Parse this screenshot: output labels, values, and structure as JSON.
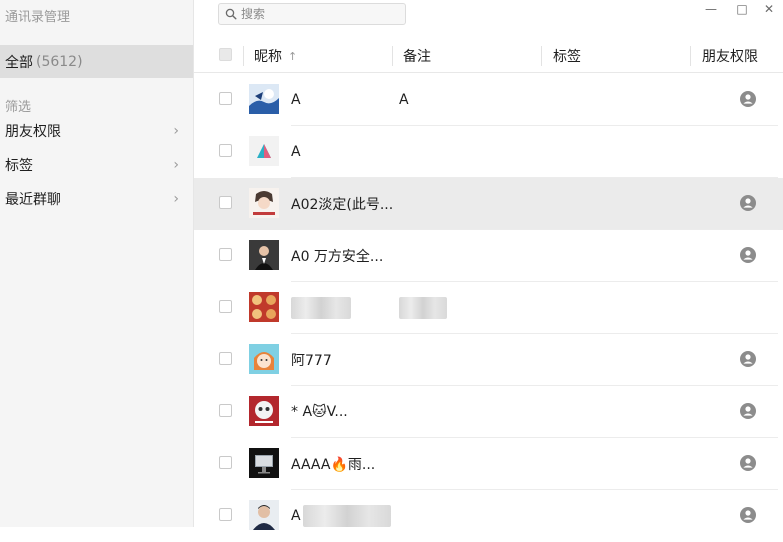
{
  "sidebar": {
    "title": "通讯录管理",
    "all_label": "全部",
    "all_count": "(5612)",
    "filter_label": "筛选",
    "items": [
      {
        "label": "朋友权限",
        "chevron": "›"
      },
      {
        "label": "标签",
        "chevron": "›"
      },
      {
        "label": "最近群聊",
        "chevron": "›"
      }
    ]
  },
  "search": {
    "placeholder": "搜索",
    "value": ""
  },
  "window_controls": {
    "minimize": "—",
    "maximize": "□",
    "close": "✕"
  },
  "table": {
    "headers": {
      "nickname": "昵称",
      "sort_indicator": "↑",
      "remark": "备注",
      "tags": "标签",
      "permission": "朋友权限"
    },
    "rows": [
      {
        "nickname": "A",
        "remark": "A",
        "avatar": "blue-illustration-avatar",
        "has_permission_icon": true,
        "blurred": false
      },
      {
        "nickname": "A",
        "remark": "",
        "avatar": "triangle-logo-avatar",
        "has_permission_icon": false,
        "blurred": false
      },
      {
        "nickname": "A02淡定(此号...",
        "remark": "",
        "avatar": "anime-character-avatar",
        "has_permission_icon": true,
        "blurred": false
      },
      {
        "nickname": "A0 万方安全...",
        "remark": "",
        "avatar": "man-in-suit-avatar",
        "has_permission_icon": true,
        "blurred": false
      },
      {
        "nickname": "",
        "remark": "",
        "avatar": "red-food-avatar",
        "has_permission_icon": false,
        "blurred": true
      },
      {
        "nickname": "阿777",
        "remark": "",
        "avatar": "cartoon-face-avatar",
        "has_permission_icon": true,
        "blurred": false
      },
      {
        "nickname": "*      A🐱V...",
        "remark": "",
        "avatar": "red-cartoon-avatar",
        "has_permission_icon": true,
        "blurred": false
      },
      {
        "nickname": "AAAA🔥雨...",
        "remark": "",
        "avatar": "monitor-avatar",
        "has_permission_icon": true,
        "blurred": false
      },
      {
        "nickname": "A",
        "remark": "",
        "avatar": "man-portrait-avatar",
        "has_permission_icon": true,
        "blurred": true
      }
    ]
  },
  "colors": {
    "sidebar_bg": "#f5f5f5",
    "selected_bg": "#dedede",
    "row_highlight": "#ebebeb",
    "icon_gray": "#8c8c8c"
  }
}
